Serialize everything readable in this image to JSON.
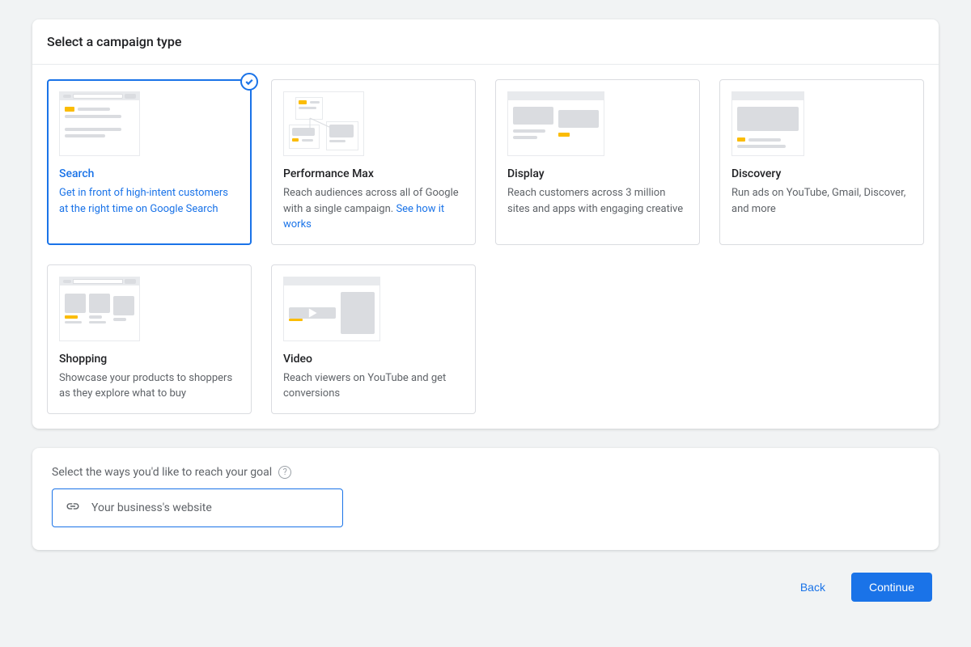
{
  "header": {
    "title": "Select a campaign type"
  },
  "cards": [
    {
      "key": "search",
      "title": "Search",
      "desc": "Get in front of high-intent customers at the right time on Google Search",
      "selected": true
    },
    {
      "key": "pmax",
      "title": "Performance Max",
      "desc": "Reach audiences across all of Google with a single campaign. ",
      "link": "See how it works"
    },
    {
      "key": "display",
      "title": "Display",
      "desc": "Reach customers across 3 million sites and apps with engaging creative"
    },
    {
      "key": "discovery",
      "title": "Discovery",
      "desc": "Run ads on YouTube, Gmail, Discover, and more"
    },
    {
      "key": "shopping",
      "title": "Shopping",
      "desc": "Showcase your products to shoppers as they explore what to buy"
    },
    {
      "key": "video",
      "title": "Video",
      "desc": "Reach viewers on YouTube and get conversions"
    }
  ],
  "goal": {
    "label": "Select the ways you'd like to reach your goal",
    "option": "Your business's website"
  },
  "footer": {
    "back": "Back",
    "continue": "Continue"
  }
}
